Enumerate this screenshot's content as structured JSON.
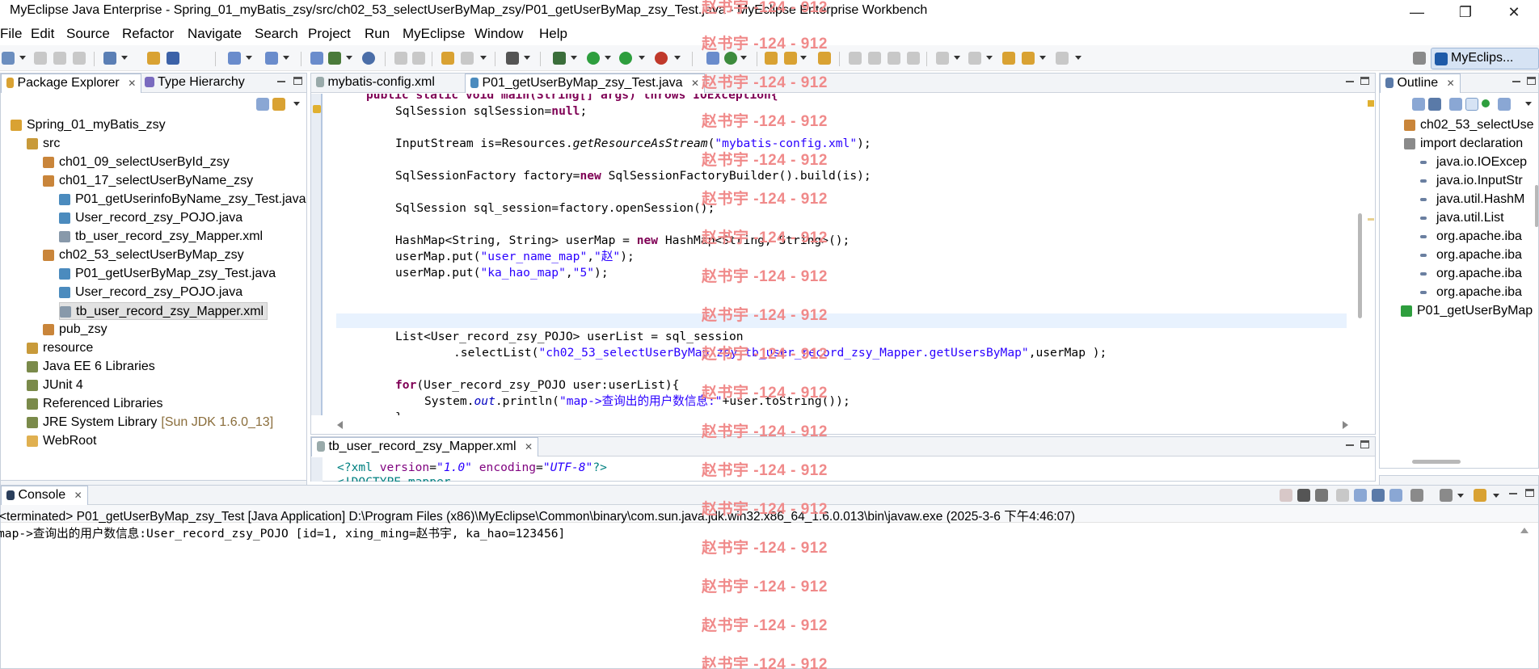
{
  "window": {
    "title": "MyEclipse Java Enterprise - Spring_01_myBatis_zsy/src/ch02_53_selectUserByMap_zsy/P01_getUserByMap_zsy_Test.java - MyEclipse Enterprise Workbench",
    "minimize": "—",
    "maximize": "❐",
    "close": "✕"
  },
  "menu": [
    "File",
    "Edit",
    "Source",
    "Refactor",
    "Navigate",
    "Search",
    "Project",
    "Run",
    "MyEclipse",
    "Window",
    "Help"
  ],
  "perspective": {
    "label": "MyEclips..."
  },
  "package_explorer": {
    "tabs": [
      "Package Explorer",
      "Type Hierarchy"
    ],
    "tree": [
      {
        "label": "Spring_01_myBatis_zsy",
        "icon": "project-icon"
      },
      {
        "label": "src",
        "icon": "source-folder-icon"
      },
      {
        "label": "ch01_09_selectUserById_zsy",
        "icon": "package-icon"
      },
      {
        "label": "ch01_17_selectUserByName_zsy",
        "icon": "package-icon"
      },
      {
        "label": "P01_getUserinfoByName_zsy_Test.java",
        "icon": "java-file-icon"
      },
      {
        "label": "User_record_zsy_POJO.java",
        "icon": "java-file-icon"
      },
      {
        "label": "tb_user_record_zsy_Mapper.xml",
        "icon": "xml-file-icon"
      },
      {
        "label": "ch02_53_selectUserByMap_zsy",
        "icon": "package-icon"
      },
      {
        "label": "P01_getUserByMap_zsy_Test.java",
        "icon": "java-file-icon"
      },
      {
        "label": "User_record_zsy_POJO.java",
        "icon": "java-file-icon"
      },
      {
        "label": "tb_user_record_zsy_Mapper.xml",
        "icon": "xml-file-icon"
      },
      {
        "label": "pub_zsy",
        "icon": "package-icon"
      },
      {
        "label": "resource",
        "icon": "source-folder-icon"
      },
      {
        "label": "Java EE 6 Libraries",
        "icon": "library-icon"
      },
      {
        "label": "JUnit 4",
        "icon": "library-icon"
      },
      {
        "label": "Referenced Libraries",
        "icon": "library-icon"
      },
      {
        "label": "JRE System Library",
        "suffix": "[Sun JDK 1.6.0_13]",
        "icon": "library-icon"
      },
      {
        "label": "WebRoot",
        "icon": "folder-icon"
      }
    ]
  },
  "editor": {
    "tabs": [
      "mybatis-config.xml",
      "P01_getUserByMap_zsy_Test.java"
    ],
    "lines": {
      "l0_a": "public static void main(String[] args) throws IOException{",
      "l1_a": "SqlSession sqlSession=",
      "l1_b": "null",
      "l1_c": ";",
      "l2_a": "InputStream is=Resources.",
      "l2_b": "getResourceAsStream",
      "l2_c": "(",
      "l2_d": "\"mybatis-config.xml\"",
      "l2_e": ");",
      "l3_a": "SqlSessionFactory factory=",
      "l3_b": "new",
      "l3_c": " SqlSessionFactoryBuilder().build(is);",
      "l4": "SqlSession sql_session=factory.openSession();",
      "l5_a": "HashMap<String, String> userMap = ",
      "l5_b": "new",
      "l5_c": " HashMap<String, String>();",
      "l6_a": "userMap.put(",
      "l6_b": "\"user_name_map\"",
      "l6_c": ",",
      "l6_d": "\"赵\"",
      "l6_e": ");",
      "l7_a": "userMap.put(",
      "l7_b": "\"ka_hao_map\"",
      "l7_c": ",",
      "l7_d": "\"5\"",
      "l7_e": ");",
      "l8": "List<User_record_zsy_POJO> userList = sql_session",
      "l9_a": ".selectList(",
      "l9_b": "\"ch02_53_selectUserByMap_zsy.tb_user_record_zsy_Mapper.getUsersByMap\"",
      "l9_c": ",userMap );",
      "l10_a": "for",
      "l10_b": "(User_record_zsy_POJO user:userList){",
      "l11_a": "System.",
      "l11_b": "out",
      "l11_c": ".println(",
      "l11_d": "\"map->查询出的用户数信息:\"",
      "l11_e": "+user.toString());",
      "l12": "}"
    }
  },
  "xml_editor": {
    "tab": "tb_user_record_zsy_Mapper.xml",
    "line1_a": "<?xml ",
    "line1_b": "version",
    "line1_c": "=",
    "line1_d": "\"1.0\"",
    "line1_e": " encoding",
    "line1_f": "=",
    "line1_g": "\"UTF-8\"",
    "line1_h": "?>",
    "line2": "<!DOCTYPE mapper"
  },
  "outline": {
    "tab": "Outline",
    "items": [
      "ch02_53_selectUse",
      "import declaration",
      "java.io.IOExcep",
      "java.io.InputStr",
      "java.util.HashM",
      "java.util.List",
      "org.apache.iba",
      "org.apache.iba",
      "org.apache.iba",
      "org.apache.iba",
      "P01_getUserByMap"
    ]
  },
  "console": {
    "tab": "Console",
    "status": "<terminated> P01_getUserByMap_zsy_Test [Java Application] D:\\Program Files (x86)\\MyEclipse\\Common\\binary\\com.sun.java.jdk.win32.x86_64_1.6.0.013\\bin\\javaw.exe (2025-3-6 下午4:46:07)",
    "output": "map->查询出的用户数信息:User_record_zsy_POJO [id=1, xing_ming=赵书宇, ka_hao=123456]"
  },
  "watermark": "赵书宇 -124 - 912",
  "colors": {
    "accent": "#d6e3f4",
    "keyword": "#7f0055",
    "string": "#2a00ff",
    "watermark": "#f08a8a"
  }
}
